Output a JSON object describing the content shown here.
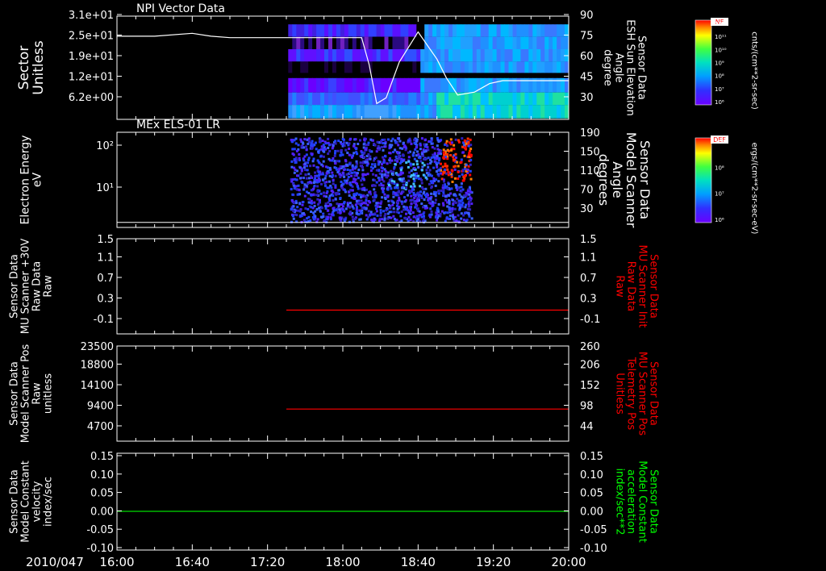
{
  "colors": {
    "background": "#000000",
    "axis": "#ffffff",
    "red_trace": "#ff0000",
    "green_trace": "#00dd00",
    "red_label": "#ff0000",
    "green_label": "#00ff00"
  },
  "time_axis": {
    "date_label": "2010/047",
    "ticks": [
      "16:00",
      "16:40",
      "17:20",
      "18:00",
      "18:40",
      "19:20",
      "20:00"
    ],
    "start_min": 960,
    "end_min": 1200
  },
  "chart_data": [
    {
      "type": "heatmap",
      "title": "NPI Vector Data",
      "left_label": [
        "Sector",
        "Unitless"
      ],
      "left_ticks": [
        "3.1e+01",
        "2.5e+01",
        "1.9e+01",
        "1.2e+01",
        "6.2e+00"
      ],
      "right_label": [
        "Sensor Data",
        "ESH Sun Elevation",
        "Angle",
        "degree"
      ],
      "right_ticks": [
        "90",
        "75",
        "60",
        "45",
        "30"
      ],
      "right_range": [
        18,
        90
      ],
      "data_start_min": 1051,
      "overlay_line": {
        "name": "ESH Sun Elevation Angle",
        "t": [
          960,
          980,
          1000,
          1010,
          1020,
          1040,
          1060,
          1080,
          1090,
          1094,
          1098,
          1103,
          1110,
          1120,
          1130,
          1135,
          1141,
          1150,
          1158,
          1165,
          1170,
          1180,
          1200
        ],
        "v": [
          76,
          76,
          78,
          76,
          75,
          75,
          75,
          75,
          75,
          56,
          29,
          33,
          58,
          79,
          60,
          47,
          35,
          37,
          43,
          45,
          45,
          45,
          45
        ]
      },
      "colorbar": {
        "label": "NF",
        "ticks": [
          "10¹²",
          "10¹¹",
          "10¹⁰",
          "10⁹",
          "10⁸",
          "10⁷",
          "10⁶"
        ],
        "units": "cnts/(cm**2-sr-sec)"
      }
    },
    {
      "type": "heatmap",
      "title": "MEx ELS-01 LR",
      "left_label": [
        "Electron Energy",
        "eV"
      ],
      "left_ticks": [
        "10²",
        "10¹"
      ],
      "right_label": [
        "Sensor Data",
        "Model Scanner",
        "Angle",
        "degrees"
      ],
      "right_ticks": [
        "190",
        "150",
        "110",
        "70",
        "30"
      ],
      "right_range": [
        0,
        190
      ],
      "data_start_min": 1052,
      "data_end_min": 1148,
      "overlay_line": {
        "name": "Model Scanner Angle",
        "t": [
          960,
          1200
        ],
        "v": [
          10,
          10
        ]
      },
      "colorbar": {
        "label": "DEF",
        "ticks": [
          "10⁹",
          "10⁸",
          "10⁷",
          "10⁶"
        ],
        "units": "ergs/(cm**2-sr-sec-eV)"
      }
    },
    {
      "type": "line",
      "left_label": [
        "Sensor Data",
        "MU Scanner +30V",
        "Raw Data",
        "Raw"
      ],
      "left_ticks": [
        "1.5",
        "1.1",
        "0.7",
        "0.3",
        "-0.1"
      ],
      "left_range": [
        -0.5,
        1.5
      ],
      "right_label": [
        "Sensor Data",
        "MU Scanner Init",
        "Raw Data",
        "Raw"
      ],
      "right_ticks": [
        "1.5",
        "1.1",
        "0.7",
        "0.3",
        "-0.1"
      ],
      "right_label_color": "red",
      "series": [
        {
          "t_start": 1050,
          "t_end": 1200,
          "value": 0.0,
          "color": "#ff0000"
        }
      ]
    },
    {
      "type": "line",
      "left_label": [
        "Sensor Data",
        "Model Scanner Pos",
        "Raw",
        "unitless"
      ],
      "left_ticks": [
        "23500",
        "18800",
        "14100",
        "9400",
        "4700"
      ],
      "left_range": [
        0,
        23500
      ],
      "right_label": [
        "Sensor Data",
        "MU Scanner Pos",
        "Telemetry Pos",
        "Unitless"
      ],
      "right_ticks": [
        "260",
        "206",
        "152",
        "98",
        "44"
      ],
      "right_label_color": "red",
      "series": [
        {
          "t_start": 1050,
          "t_end": 1200,
          "value": 7920,
          "color": "#ff0000"
        }
      ]
    },
    {
      "type": "line",
      "left_label": [
        "Sensor Data",
        "Model Constant",
        "velocity",
        "index/sec"
      ],
      "left_ticks": [
        "0.15",
        "0.10",
        "0.05",
        "0.00",
        "-0.05",
        "-0.10"
      ],
      "left_range": [
        -0.1,
        0.15
      ],
      "right_label": [
        "Sensor Data",
        "Model Constant",
        "acceleration",
        "index/sec**2"
      ],
      "right_ticks": [
        "0.15",
        "0.10",
        "0.05",
        "0.00",
        "-0.05",
        "-0.10"
      ],
      "right_label_color": "green",
      "series": [
        {
          "t_start": 960,
          "t_end": 1200,
          "value": 0.0,
          "color": "#00dd00"
        }
      ]
    }
  ]
}
